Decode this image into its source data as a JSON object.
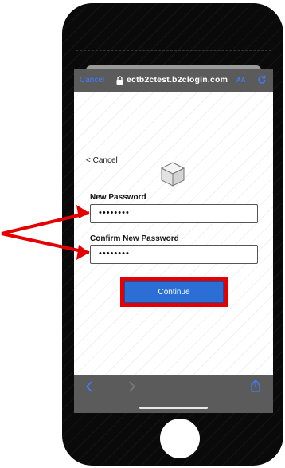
{
  "browser": {
    "cancel_label": "Cancel",
    "url": "ectb2ctest.b2clogin.com",
    "text_size_label": "AA"
  },
  "page": {
    "cancel_label": "< Cancel",
    "new_password": {
      "label": "New Password",
      "value": "••••••••"
    },
    "confirm_password": {
      "label": "Confirm New Password",
      "value": "••••••••"
    },
    "continue_label": "Continue"
  },
  "icons": {
    "lock": "lock-icon",
    "reload": "reload-icon",
    "logo": "cube-logo-icon",
    "back": "back-arrow-icon",
    "forward": "forward-arrow-icon",
    "share": "share-icon"
  },
  "colors": {
    "annotation_red": "#e50000",
    "button_blue": "#2b6fd6",
    "link_blue": "#3d7dff",
    "toolbar_gray": "#5b5b5b"
  }
}
